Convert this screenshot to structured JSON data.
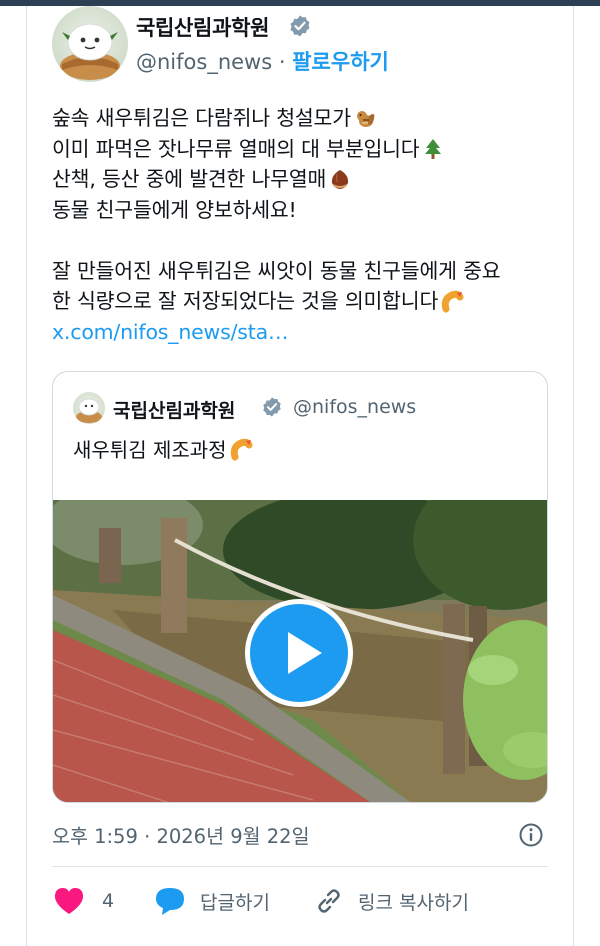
{
  "author": {
    "name": "국립산림과학원",
    "handle": "@nifos_news",
    "separator": "·",
    "follow_label": "팔로우하기"
  },
  "tweet": {
    "lines": [
      "숲속 새우튀김은 다람쥐나 청설모가",
      "이미 파먹은 잣나무류 열매의 대 부분입니다",
      "산책, 등산 중에 발견한 나무열매",
      "동물 친구들에게 양보하세요!",
      "잘 만들어진 새우튀김은 씨앗이 동물 친구들에게 중요",
      "한 식량으로 잘 저장되었다는 것을 의미합니다"
    ],
    "link": "x.com/nifos_news/sta…",
    "emoji_icons": [
      "chipmunk-emoji",
      "evergreen-tree-emoji",
      "chestnut-emoji",
      "fried-shrimp-emoji"
    ]
  },
  "quote": {
    "name": "국립산림과학원",
    "handle": "@nifos_news",
    "text": "새우튀김 제조과정"
  },
  "timestamp": "오후 1:59 · 2026년 9월 22일",
  "actions": {
    "like_count": "4",
    "reply_label": "답글하기",
    "copy_link_label": "링크 복사하기"
  },
  "colors": {
    "accent": "#1d9bf0",
    "like": "#f91880",
    "muted": "#536471",
    "topbar": "#2d4053"
  }
}
